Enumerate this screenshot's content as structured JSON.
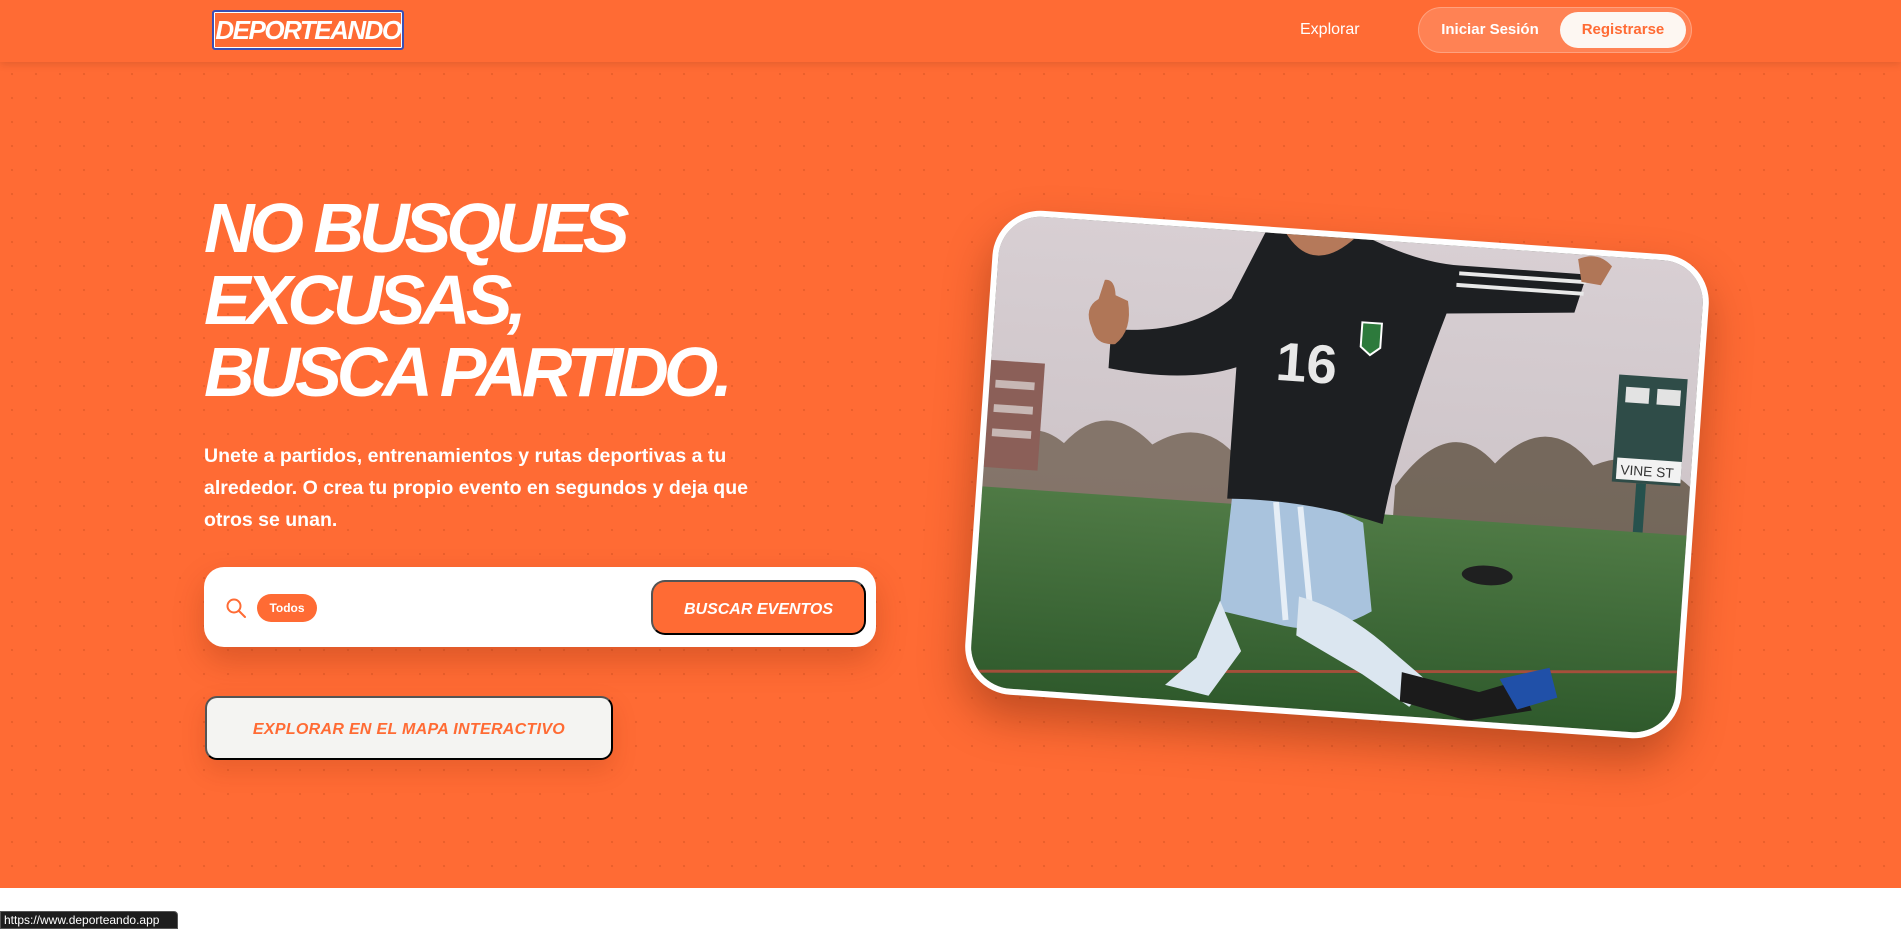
{
  "header": {
    "logo": "DEPORTEANDO",
    "nav_explore": "Explorar",
    "login_label": "Iniciar Sesión",
    "register_label": "Registrarse"
  },
  "hero": {
    "headline_lines": [
      "NO BUSQUES",
      "EXCUSAS,",
      "BUSCA PARTIDO."
    ],
    "subtitle": "Unete a partidos, entrenamientos y rutas deportivas a tu alrededor. O crea tu propio evento en segundos y deja que otros se unan.",
    "search": {
      "filter_chip": "Todos",
      "button_label": "BUSCAR EVENTOS"
    },
    "map_button_label": "EXPLORAR EN EL MAPA INTERACTIVO",
    "photo": {
      "jersey_number": "16",
      "scoreboard_text": "VINE ST"
    }
  },
  "status_bar": {
    "url": "https://www.deporteando.app"
  },
  "colors": {
    "brand_orange": "#ff6b34",
    "white": "#ffffff",
    "logo_border": "#3a4fb5"
  },
  "icons": {
    "search": "search-icon"
  }
}
